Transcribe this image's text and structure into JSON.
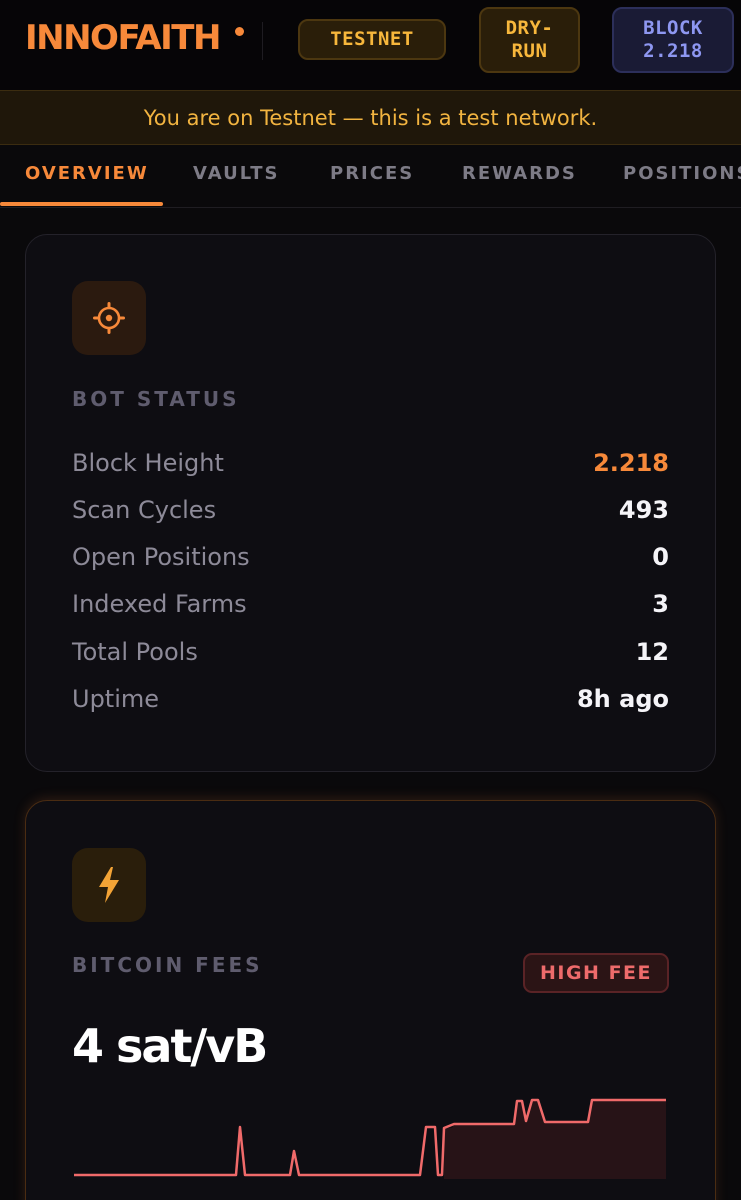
{
  "header": {
    "logo": "INNOFAITH",
    "network_pill": "TESTNET",
    "mode_pill": "DRY-\nRUN",
    "block_pill": "BLOCK\n2.218",
    "accent_color": "#f7893a"
  },
  "banner": {
    "text": "You are on Testnet — this is a test network."
  },
  "tabs": [
    "OVERVIEW",
    "VAULTS",
    "PRICES",
    "REWARDS",
    "POSITIONS"
  ],
  "active_tab": "OVERVIEW",
  "bot_status": {
    "icon": "gear-icon",
    "label": "BOT STATUS",
    "rows": [
      {
        "label": "Block Height",
        "value": "2.218"
      },
      {
        "label": "Scan Cycles",
        "value": "493"
      },
      {
        "label": "Open Positions",
        "value": "0"
      },
      {
        "label": "Indexed Farms",
        "value": "3"
      },
      {
        "label": "Total Pools",
        "value": "12"
      },
      {
        "label": "Uptime",
        "value": "8h ago"
      }
    ]
  },
  "bitcoin_fees": {
    "icon": "lightning-icon",
    "label": "BITCOIN FEES",
    "badge": "HIGH FEE",
    "value": "4 sat/vB",
    "sparkline_color": "#f06a6a"
  }
}
